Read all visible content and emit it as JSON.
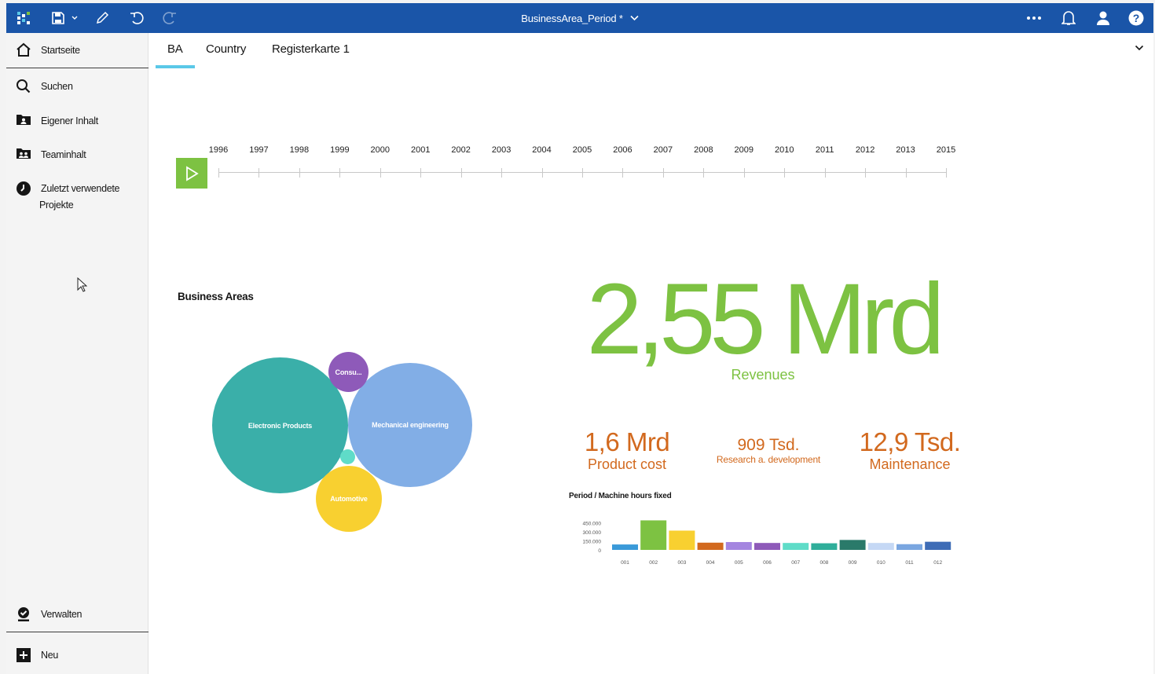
{
  "topbar": {
    "title": "BusinessArea_Period *",
    "icons": [
      "grid-apps-icon",
      "save-icon",
      "chevron-down-icon",
      "edit-pencil-icon",
      "undo-icon",
      "redo-icon",
      "more-icon",
      "bell-icon",
      "user-icon",
      "help-icon"
    ]
  },
  "sidebar": {
    "items": [
      {
        "label": "Startseite",
        "icon": "home-icon"
      },
      {
        "label": "Suchen",
        "icon": "search-icon"
      },
      {
        "label": "Eigener Inhalt",
        "icon": "my-content-icon"
      },
      {
        "label": "Teaminhalt",
        "icon": "team-content-icon"
      },
      {
        "label": "Zuletzt verwendete Projekte",
        "icon": "recent-icon",
        "line1": "Zuletzt verwendete",
        "line2": "Projekte"
      }
    ],
    "bottom": [
      {
        "label": "Verwalten",
        "icon": "manage-icon"
      },
      {
        "label": "Neu",
        "icon": "plus-icon"
      }
    ]
  },
  "tabs": [
    {
      "label": "BA",
      "active": true
    },
    {
      "label": "Country"
    },
    {
      "label": "Registerkarte 1"
    }
  ],
  "timeline": {
    "years": [
      "1996",
      "1997",
      "1998",
      "1999",
      "2000",
      "2001",
      "2002",
      "2003",
      "2004",
      "2005",
      "2006",
      "2007",
      "2008",
      "2009",
      "2010",
      "2011",
      "2012",
      "2013",
      "2015"
    ]
  },
  "business_areas": {
    "title": "Business Areas",
    "bubbles": [
      {
        "label": "Electronic Products",
        "color": "#3aafa9"
      },
      {
        "label": "Mechanical engineering",
        "color": "#82aee6"
      },
      {
        "label": "Consu...",
        "color": "#8e5ab9"
      },
      {
        "label": "Automotive",
        "color": "#f8d030"
      },
      {
        "label": "",
        "color": "#5fdcc8"
      }
    ]
  },
  "kpis": {
    "revenues": {
      "value": "2,55 Mrd",
      "label": "Revenues",
      "color": "#7dc242"
    },
    "product_cost": {
      "value": "1,6 Mrd",
      "label": "Product cost",
      "color": "#d2691e"
    },
    "research": {
      "value": "909 Tsd.",
      "label": "Research a. development",
      "color": "#d2691e"
    },
    "maintenance": {
      "value": "12,9 Tsd.",
      "label": "Maintenance",
      "color": "#d2691e"
    }
  },
  "chart_data": {
    "type": "bar",
    "title": "Period / Machine hours fixed",
    "categories": [
      "001",
      "002",
      "003",
      "004",
      "005",
      "006",
      "007",
      "008",
      "009",
      "010",
      "011",
      "012"
    ],
    "values": [
      90000,
      490000,
      320000,
      120000,
      130000,
      115000,
      115000,
      110000,
      165000,
      115000,
      95000,
      135000
    ],
    "colors": [
      "#3a9ad9",
      "#7dc242",
      "#f8d030",
      "#d2691e",
      "#a485e0",
      "#8e5ab9",
      "#5fdcc8",
      "#2fae9a",
      "#2a7a6a",
      "#c5d8f5",
      "#7aa6e0",
      "#3e6cb6"
    ],
    "ytick_labels": [
      "450.000",
      "300.000",
      "150.000",
      "0"
    ],
    "ylim": [
      0,
      600000
    ]
  }
}
